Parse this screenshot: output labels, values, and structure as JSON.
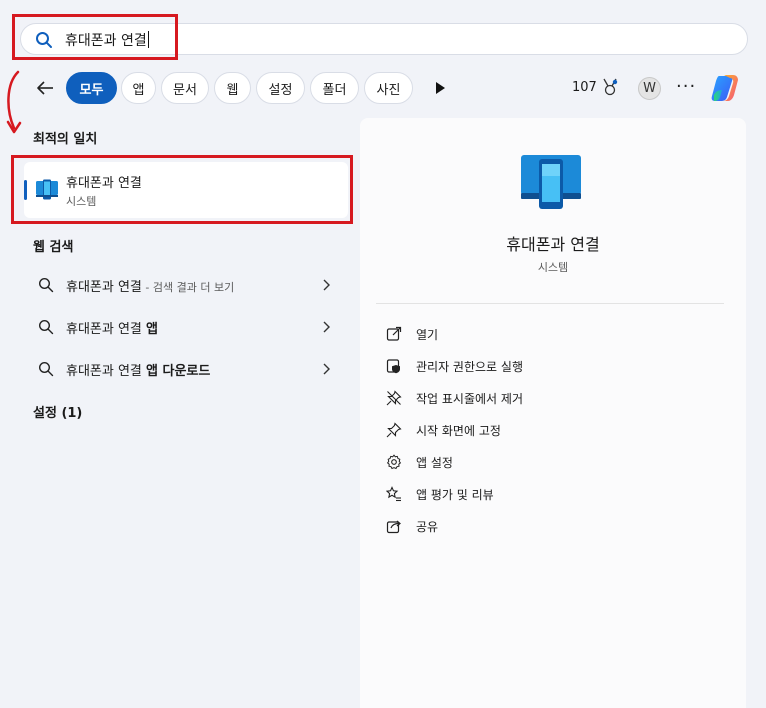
{
  "search": {
    "query": "휴대폰과 연결"
  },
  "filters": {
    "items": [
      {
        "label": "모두",
        "active": true
      },
      {
        "label": "앱",
        "active": false
      },
      {
        "label": "문서",
        "active": false
      },
      {
        "label": "웹",
        "active": false
      },
      {
        "label": "설정",
        "active": false
      },
      {
        "label": "폴더",
        "active": false
      },
      {
        "label": "사진",
        "active": false
      }
    ],
    "points": "107",
    "avatar_initial": "W",
    "more": "···"
  },
  "best_match": {
    "section_title": "최적의 일치",
    "name": "휴대폰과 연결",
    "type": "시스템"
  },
  "web_search": {
    "section_title": "웹 검색",
    "rows": [
      {
        "query": "휴대폰과 연결",
        "bold_suffix": "",
        "hint": " - 검색 결과 더 보기"
      },
      {
        "query": "휴대폰과 연결 ",
        "bold_suffix": "앱",
        "hint": ""
      },
      {
        "query": "휴대폰과 연결 ",
        "bold_suffix": "앱 다운로드",
        "hint": ""
      }
    ]
  },
  "settings": {
    "section_title": "설정 (1)"
  },
  "detail": {
    "title": "휴대폰과 연결",
    "type": "시스템",
    "actions": [
      {
        "label": "열기",
        "icon": "open-icon"
      },
      {
        "label": "관리자 권한으로 실행",
        "icon": "shield-icon"
      },
      {
        "label": "작업 표시줄에서 제거",
        "icon": "unpin-icon"
      },
      {
        "label": "시작 화면에 고정",
        "icon": "pin-icon"
      },
      {
        "label": "앱 설정",
        "icon": "gear-icon"
      },
      {
        "label": "앱 평가 및 리뷰",
        "icon": "star-list-icon"
      },
      {
        "label": "공유",
        "icon": "share-icon"
      }
    ]
  },
  "colors": {
    "accent": "#0f5fbd",
    "highlight_box": "#d61920"
  }
}
